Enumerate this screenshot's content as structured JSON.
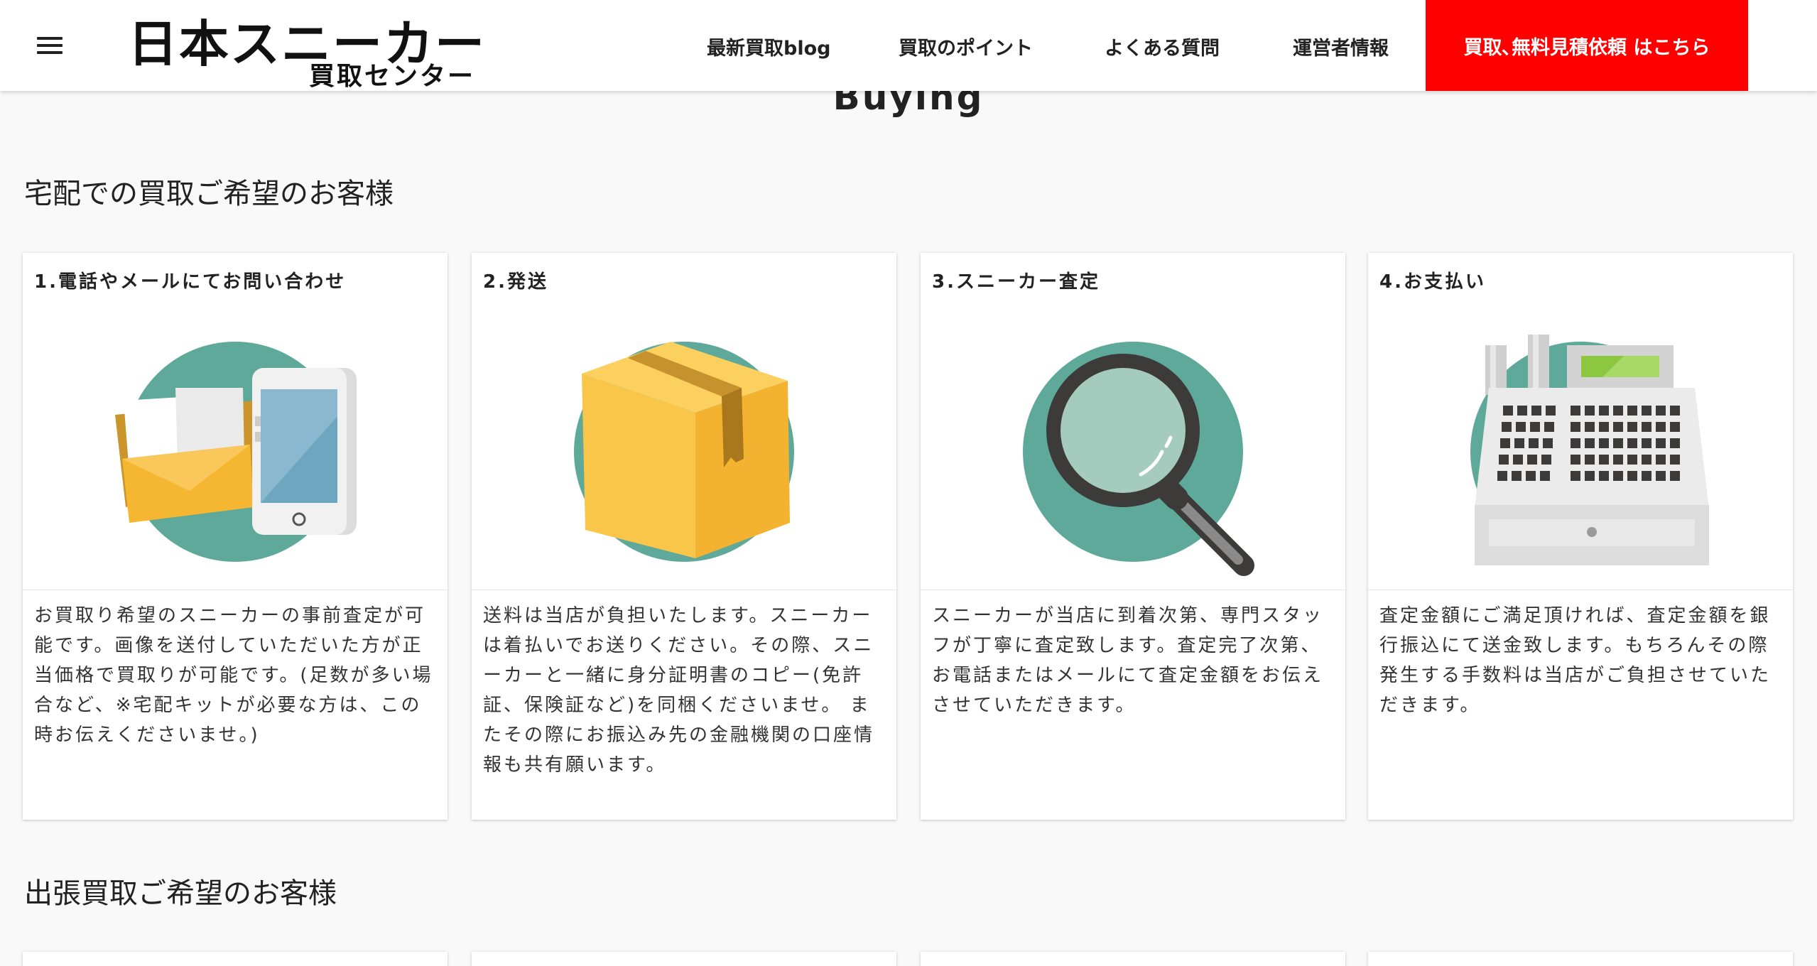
{
  "header": {
    "logo_main": "日本スニーカー",
    "logo_sub": "買取センター",
    "nav": [
      {
        "label": "最新買取blog"
      },
      {
        "label": "買取のポイント"
      },
      {
        "label": "よくある質問"
      },
      {
        "label": "運営者情報"
      }
    ],
    "cta_label": "買取､無料見積依頼 はこちら"
  },
  "section_en": "Buying",
  "delivery": {
    "title": "宅配での買取ご希望のお客様",
    "cards": [
      {
        "title": "1.電話やメールにてお問い合わせ",
        "icon": "mail-phone-icon",
        "text": "お買取り希望のスニーカーの事前査定が可能です。画像を送付していただいた方が正当価格で買取りが可能です。(足数が多い場合など、※宅配キットが必要な方は、この時お伝えくださいませ。)"
      },
      {
        "title": "2.発送",
        "icon": "cardboard-box-icon",
        "text": "送料は当店が負担いたします。スニーカーは着払いでお送りください。その際、スニーカーと一緒に身分証明書のコピー(免許証、保険証など)を同梱くださいませ。 またその際にお振込み先の金融機関の口座情報も共有願います。"
      },
      {
        "title": "3.スニーカー査定",
        "icon": "magnifier-icon",
        "text": "スニーカーが当店に到着次第、専門スタッフが丁寧に査定致します。査定完了次第、お電話またはメールにて査定金額をお伝えさせていただきます。"
      },
      {
        "title": "4.お支払い",
        "icon": "cash-register-icon",
        "text": "査定金額にご満足頂ければ、査定金額を銀行振込にて送金致します。もちろんその際発生する手数料は当店がご負担させていただきます。"
      }
    ]
  },
  "visit": {
    "title": "出張買取ご希望のお客様"
  },
  "colors": {
    "accent": "#fe0000",
    "teal": "#5fa99b",
    "box_yellow": "#f8c244"
  }
}
